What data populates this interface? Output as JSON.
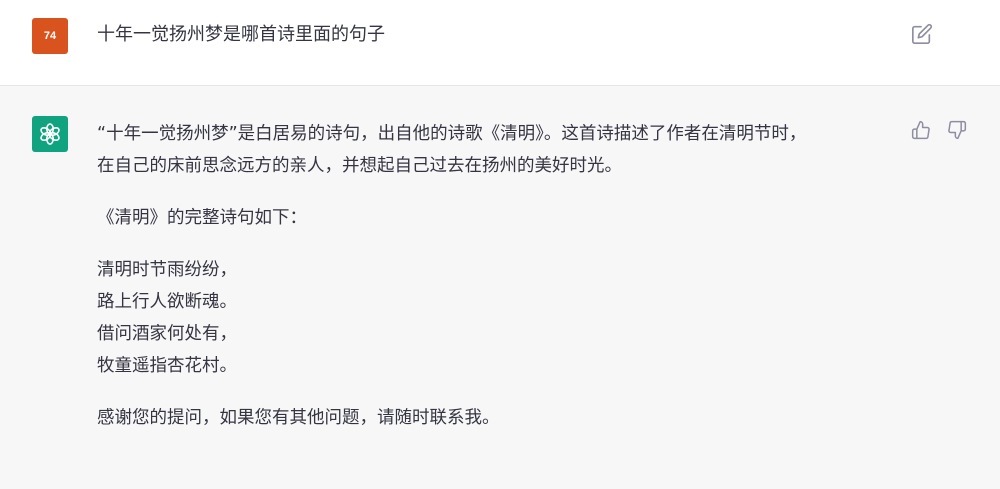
{
  "user_message": {
    "avatar_initials": "74",
    "text": "十年一觉扬州梦是哪首诗里面的句子"
  },
  "assistant_message": {
    "intro_line1": "“十年一觉扬州梦”是白居易的诗句，出自他的诗歌《清明》。这首诗描述了作者在清明节时，",
    "intro_line2": "在自己的床前思念远方的亲人，并想起自己过去在扬州的美好时光。",
    "full_poem_heading": "《清明》的完整诗句如下：",
    "poem_lines": [
      "清明时节雨纷纷，",
      "路上行人欲断魂。",
      "借问酒家何处有，",
      "牧童遥指杏花村。"
    ],
    "closing": "感谢您的提问，如果您有其他问题，请随时联系我。"
  },
  "colors": {
    "user_avatar": "#d9531e",
    "assistant_avatar": "#10a37f",
    "text": "#343541",
    "assistant_bg": "#f7f7f8"
  },
  "icons": {
    "edit": "edit-icon",
    "thumb_up": "thumbs-up-icon",
    "thumb_down": "thumbs-down-icon",
    "assistant_logo": "openai-logo-icon"
  }
}
